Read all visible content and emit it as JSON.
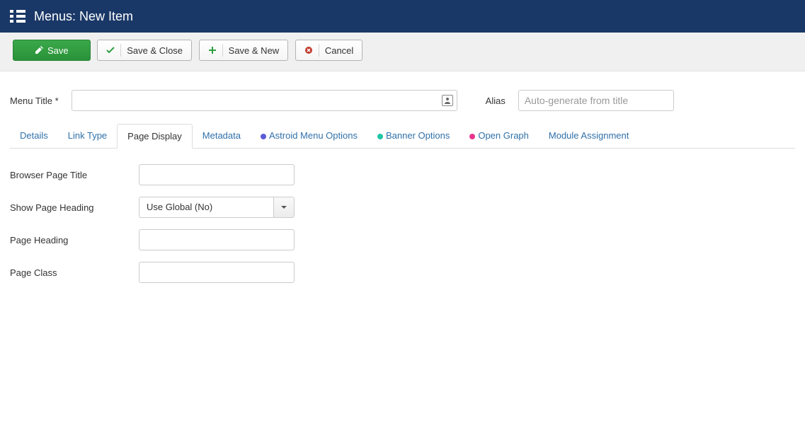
{
  "header": {
    "title": "Menus: New Item"
  },
  "toolbar": {
    "save": "Save",
    "save_close": "Save & Close",
    "save_new": "Save & New",
    "cancel": "Cancel"
  },
  "title_row": {
    "menu_title_label": "Menu Title *",
    "alias_label": "Alias",
    "alias_placeholder": "Auto-generate from title"
  },
  "tabs": [
    {
      "label": "Details"
    },
    {
      "label": "Link Type"
    },
    {
      "label": "Page Display",
      "active": true
    },
    {
      "label": "Metadata"
    },
    {
      "label": "Astroid Menu Options",
      "color": "purple"
    },
    {
      "label": "Banner Options",
      "color": "teal"
    },
    {
      "label": "Open Graph",
      "color": "pink"
    },
    {
      "label": "Module Assignment"
    }
  ],
  "page_display": {
    "browser_page_title_label": "Browser Page Title",
    "show_page_heading_label": "Show Page Heading",
    "show_page_heading_value": "Use Global (No)",
    "page_heading_label": "Page Heading",
    "page_class_label": "Page Class"
  }
}
